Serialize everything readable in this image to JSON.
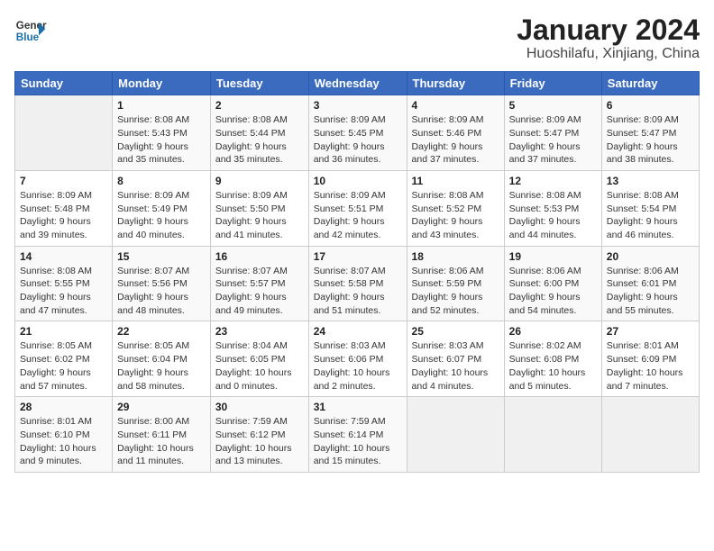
{
  "header": {
    "logo_general": "General",
    "logo_blue": "Blue",
    "title": "January 2024",
    "subtitle": "Huoshilafu, Xinjiang, China"
  },
  "calendar": {
    "weekdays": [
      "Sunday",
      "Monday",
      "Tuesday",
      "Wednesday",
      "Thursday",
      "Friday",
      "Saturday"
    ],
    "weeks": [
      [
        {
          "day": "",
          "sunrise": "",
          "sunset": "",
          "daylight": ""
        },
        {
          "day": "1",
          "sunrise": "Sunrise: 8:08 AM",
          "sunset": "Sunset: 5:43 PM",
          "daylight": "Daylight: 9 hours and 35 minutes."
        },
        {
          "day": "2",
          "sunrise": "Sunrise: 8:08 AM",
          "sunset": "Sunset: 5:44 PM",
          "daylight": "Daylight: 9 hours and 35 minutes."
        },
        {
          "day": "3",
          "sunrise": "Sunrise: 8:09 AM",
          "sunset": "Sunset: 5:45 PM",
          "daylight": "Daylight: 9 hours and 36 minutes."
        },
        {
          "day": "4",
          "sunrise": "Sunrise: 8:09 AM",
          "sunset": "Sunset: 5:46 PM",
          "daylight": "Daylight: 9 hours and 37 minutes."
        },
        {
          "day": "5",
          "sunrise": "Sunrise: 8:09 AM",
          "sunset": "Sunset: 5:47 PM",
          "daylight": "Daylight: 9 hours and 37 minutes."
        },
        {
          "day": "6",
          "sunrise": "Sunrise: 8:09 AM",
          "sunset": "Sunset: 5:47 PM",
          "daylight": "Daylight: 9 hours and 38 minutes."
        }
      ],
      [
        {
          "day": "7",
          "sunrise": "Sunrise: 8:09 AM",
          "sunset": "Sunset: 5:48 PM",
          "daylight": "Daylight: 9 hours and 39 minutes."
        },
        {
          "day": "8",
          "sunrise": "Sunrise: 8:09 AM",
          "sunset": "Sunset: 5:49 PM",
          "daylight": "Daylight: 9 hours and 40 minutes."
        },
        {
          "day": "9",
          "sunrise": "Sunrise: 8:09 AM",
          "sunset": "Sunset: 5:50 PM",
          "daylight": "Daylight: 9 hours and 41 minutes."
        },
        {
          "day": "10",
          "sunrise": "Sunrise: 8:09 AM",
          "sunset": "Sunset: 5:51 PM",
          "daylight": "Daylight: 9 hours and 42 minutes."
        },
        {
          "day": "11",
          "sunrise": "Sunrise: 8:08 AM",
          "sunset": "Sunset: 5:52 PM",
          "daylight": "Daylight: 9 hours and 43 minutes."
        },
        {
          "day": "12",
          "sunrise": "Sunrise: 8:08 AM",
          "sunset": "Sunset: 5:53 PM",
          "daylight": "Daylight: 9 hours and 44 minutes."
        },
        {
          "day": "13",
          "sunrise": "Sunrise: 8:08 AM",
          "sunset": "Sunset: 5:54 PM",
          "daylight": "Daylight: 9 hours and 46 minutes."
        }
      ],
      [
        {
          "day": "14",
          "sunrise": "Sunrise: 8:08 AM",
          "sunset": "Sunset: 5:55 PM",
          "daylight": "Daylight: 9 hours and 47 minutes."
        },
        {
          "day": "15",
          "sunrise": "Sunrise: 8:07 AM",
          "sunset": "Sunset: 5:56 PM",
          "daylight": "Daylight: 9 hours and 48 minutes."
        },
        {
          "day": "16",
          "sunrise": "Sunrise: 8:07 AM",
          "sunset": "Sunset: 5:57 PM",
          "daylight": "Daylight: 9 hours and 49 minutes."
        },
        {
          "day": "17",
          "sunrise": "Sunrise: 8:07 AM",
          "sunset": "Sunset: 5:58 PM",
          "daylight": "Daylight: 9 hours and 51 minutes."
        },
        {
          "day": "18",
          "sunrise": "Sunrise: 8:06 AM",
          "sunset": "Sunset: 5:59 PM",
          "daylight": "Daylight: 9 hours and 52 minutes."
        },
        {
          "day": "19",
          "sunrise": "Sunrise: 8:06 AM",
          "sunset": "Sunset: 6:00 PM",
          "daylight": "Daylight: 9 hours and 54 minutes."
        },
        {
          "day": "20",
          "sunrise": "Sunrise: 8:06 AM",
          "sunset": "Sunset: 6:01 PM",
          "daylight": "Daylight: 9 hours and 55 minutes."
        }
      ],
      [
        {
          "day": "21",
          "sunrise": "Sunrise: 8:05 AM",
          "sunset": "Sunset: 6:02 PM",
          "daylight": "Daylight: 9 hours and 57 minutes."
        },
        {
          "day": "22",
          "sunrise": "Sunrise: 8:05 AM",
          "sunset": "Sunset: 6:04 PM",
          "daylight": "Daylight: 9 hours and 58 minutes."
        },
        {
          "day": "23",
          "sunrise": "Sunrise: 8:04 AM",
          "sunset": "Sunset: 6:05 PM",
          "daylight": "Daylight: 10 hours and 0 minutes."
        },
        {
          "day": "24",
          "sunrise": "Sunrise: 8:03 AM",
          "sunset": "Sunset: 6:06 PM",
          "daylight": "Daylight: 10 hours and 2 minutes."
        },
        {
          "day": "25",
          "sunrise": "Sunrise: 8:03 AM",
          "sunset": "Sunset: 6:07 PM",
          "daylight": "Daylight: 10 hours and 4 minutes."
        },
        {
          "day": "26",
          "sunrise": "Sunrise: 8:02 AM",
          "sunset": "Sunset: 6:08 PM",
          "daylight": "Daylight: 10 hours and 5 minutes."
        },
        {
          "day": "27",
          "sunrise": "Sunrise: 8:01 AM",
          "sunset": "Sunset: 6:09 PM",
          "daylight": "Daylight: 10 hours and 7 minutes."
        }
      ],
      [
        {
          "day": "28",
          "sunrise": "Sunrise: 8:01 AM",
          "sunset": "Sunset: 6:10 PM",
          "daylight": "Daylight: 10 hours and 9 minutes."
        },
        {
          "day": "29",
          "sunrise": "Sunrise: 8:00 AM",
          "sunset": "Sunset: 6:11 PM",
          "daylight": "Daylight: 10 hours and 11 minutes."
        },
        {
          "day": "30",
          "sunrise": "Sunrise: 7:59 AM",
          "sunset": "Sunset: 6:12 PM",
          "daylight": "Daylight: 10 hours and 13 minutes."
        },
        {
          "day": "31",
          "sunrise": "Sunrise: 7:59 AM",
          "sunset": "Sunset: 6:14 PM",
          "daylight": "Daylight: 10 hours and 15 minutes."
        },
        {
          "day": "",
          "sunrise": "",
          "sunset": "",
          "daylight": ""
        },
        {
          "day": "",
          "sunrise": "",
          "sunset": "",
          "daylight": ""
        },
        {
          "day": "",
          "sunrise": "",
          "sunset": "",
          "daylight": ""
        }
      ]
    ]
  }
}
